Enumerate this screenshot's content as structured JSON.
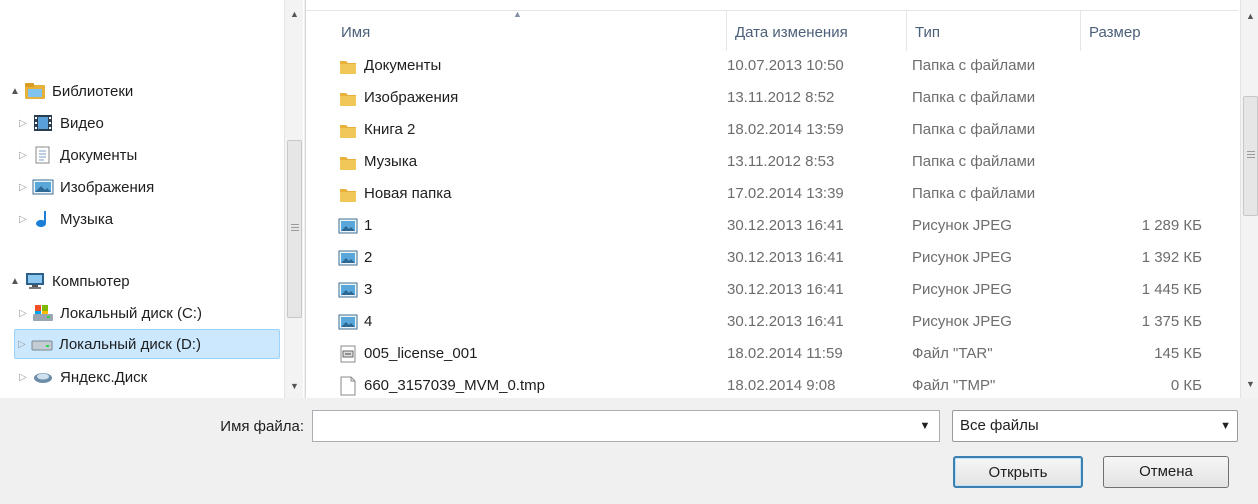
{
  "nav": {
    "items": [
      {
        "label": "Библиотеки",
        "expander": "▲",
        "icon": "libraries-icon",
        "expanded": true,
        "selected": false
      },
      {
        "label": "Видео",
        "expander": "▷",
        "icon": "video-icon",
        "expanded": false,
        "selected": false
      },
      {
        "label": "Документы",
        "expander": "▷",
        "icon": "documents-icon",
        "expanded": false,
        "selected": false
      },
      {
        "label": "Изображения",
        "expander": "▷",
        "icon": "pictures-icon",
        "expanded": false,
        "selected": false
      },
      {
        "label": "Музыка",
        "expander": "▷",
        "icon": "music-icon",
        "expanded": false,
        "selected": false
      },
      {
        "label": "Компьютер",
        "expander": "▲",
        "icon": "computer-icon",
        "expanded": true,
        "selected": false
      },
      {
        "label": "Локальный диск (C:)",
        "expander": "▷",
        "icon": "system-drive-icon",
        "expanded": false,
        "selected": false
      },
      {
        "label": "Локальный диск (D:)",
        "expander": "▷",
        "icon": "drive-icon",
        "expanded": false,
        "selected": true
      },
      {
        "label": "Яндекс.Диск",
        "expander": "▷",
        "icon": "yandex-disk-icon",
        "expanded": false,
        "selected": false
      }
    ]
  },
  "columns": {
    "name": "Имя",
    "date": "Дата изменения",
    "type": "Тип",
    "size": "Размер",
    "sort_indicator": "▲"
  },
  "files": [
    {
      "name": "Документы",
      "date": "10.07.2013 10:50",
      "type": "Папка с файлами",
      "size": "",
      "icon": "folder-icon"
    },
    {
      "name": "Изображения",
      "date": "13.11.2012 8:52",
      "type": "Папка с файлами",
      "size": "",
      "icon": "folder-icon"
    },
    {
      "name": "Книга 2",
      "date": "18.02.2014 13:59",
      "type": "Папка с файлами",
      "size": "",
      "icon": "folder-icon"
    },
    {
      "name": "Музыка",
      "date": "13.11.2012 8:53",
      "type": "Папка с файлами",
      "size": "",
      "icon": "folder-icon"
    },
    {
      "name": "Новая папка",
      "date": "17.02.2014 13:39",
      "type": "Папка с файлами",
      "size": "",
      "icon": "folder-icon"
    },
    {
      "name": "1",
      "date": "30.12.2013 16:41",
      "type": "Рисунок JPEG",
      "size": "1 289 КБ",
      "icon": "image-file-icon"
    },
    {
      "name": "2",
      "date": "30.12.2013 16:41",
      "type": "Рисунок JPEG",
      "size": "1 392 КБ",
      "icon": "image-file-icon"
    },
    {
      "name": "3",
      "date": "30.12.2013 16:41",
      "type": "Рисунок JPEG",
      "size": "1 445 КБ",
      "icon": "image-file-icon"
    },
    {
      "name": "4",
      "date": "30.12.2013 16:41",
      "type": "Рисунок JPEG",
      "size": "1 375 КБ",
      "icon": "image-file-icon"
    },
    {
      "name": "005_license_001",
      "date": "18.02.2014 11:59",
      "type": "Файл \"TAR\"",
      "size": "145 КБ",
      "icon": "archive-file-icon"
    },
    {
      "name": "660_3157039_MVM_0.tmp",
      "date": "18.02.2014 9:08",
      "type": "Файл \"TMP\"",
      "size": "0 КБ",
      "icon": "blank-file-icon"
    }
  ],
  "footer": {
    "filename_label": "Имя файла:",
    "filename_value": "",
    "filename_dropdown": "▼",
    "filter_value": "Все файлы",
    "filter_arrow": "▼",
    "open_label": "Открыть",
    "cancel_label": "Отмена"
  },
  "scroll": {
    "up": "▲",
    "down": "▼"
  },
  "colors": {
    "folder": "#e8b23a",
    "selection": "#cce8ff",
    "header_text": "#4c607a",
    "button_border_default": "#3c7fb1"
  }
}
